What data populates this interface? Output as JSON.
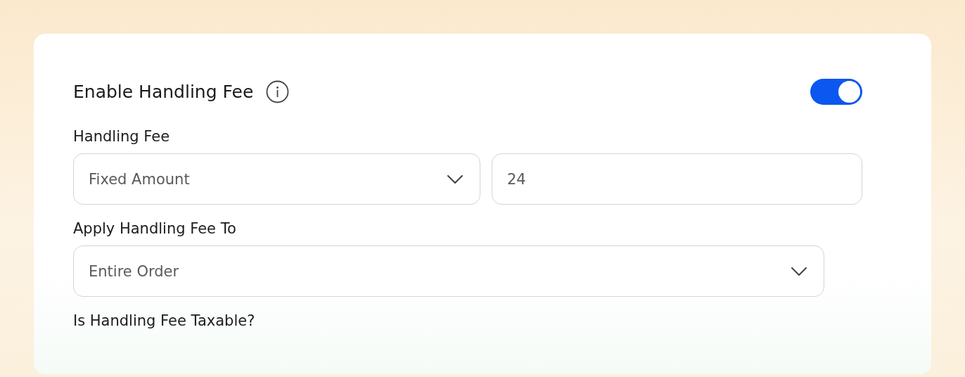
{
  "header": {
    "title": "Enable Handling Fee",
    "enabled": true
  },
  "fields": [
    {
      "label": "Handling Fee",
      "controls": [
        {
          "kind": "select",
          "value": "Fixed Amount"
        },
        {
          "kind": "input",
          "value": "24"
        }
      ]
    },
    {
      "label": "Apply Handling Fee To",
      "controls": [
        {
          "kind": "select",
          "value": "Entire Order"
        }
      ]
    },
    {
      "label": "Is Handling Fee Taxable?"
    }
  ]
}
